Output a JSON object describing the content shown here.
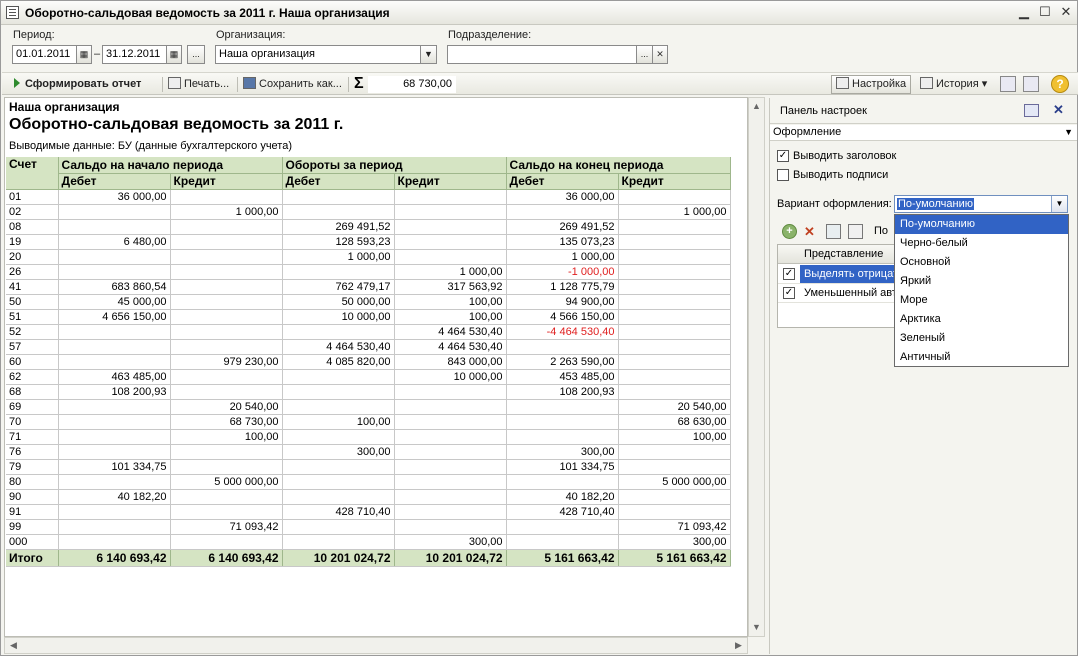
{
  "window": {
    "title": "Оборотно-сальдовая ведомость за 2011 г. Наша организация"
  },
  "filters": {
    "period_label": "Период:",
    "period_from": "01.01.2011",
    "period_sep": "–",
    "period_to": "31.12.2011",
    "period_btn": "...",
    "org_label": "Организация:",
    "org_value": "Наша организация",
    "dept_label": "Подразделение:",
    "dept_value": "",
    "dept_btn": "...",
    "dept_clear": "✕"
  },
  "toolbar": {
    "generate": "Сформировать отчет",
    "print": "Печать...",
    "save": "Сохранить как...",
    "sigma": "Σ",
    "sum_value": "68 730,00",
    "settings": "Настройка",
    "history": "История ▾",
    "help": "?"
  },
  "report": {
    "org": "Наша организация",
    "title": "Оборотно-сальдовая ведомость за 2011 г.",
    "subtitle": "Выводимые данные:  БУ (данные бухгалтерского учета)",
    "headers": {
      "account": "Счет",
      "start": "Сальдо на начало периода",
      "turnover": "Обороты за период",
      "end": "Сальдо на конец периода",
      "debit": "Дебет",
      "credit": "Кредит"
    },
    "rows": [
      [
        "01",
        "36 000,00",
        "",
        "",
        "",
        "36 000,00",
        ""
      ],
      [
        "02",
        "",
        "1 000,00",
        "",
        "",
        "",
        "1 000,00"
      ],
      [
        "08",
        "",
        "",
        "269 491,52",
        "",
        "269 491,52",
        ""
      ],
      [
        "19",
        "6 480,00",
        "",
        "128 593,23",
        "",
        "135 073,23",
        ""
      ],
      [
        "20",
        "",
        "",
        "1 000,00",
        "",
        "1 000,00",
        ""
      ],
      [
        "26",
        "",
        "",
        "",
        "1 000,00",
        "-1 000,00",
        ""
      ],
      [
        "41",
        "683 860,54",
        "",
        "762 479,17",
        "317 563,92",
        "1 128 775,79",
        ""
      ],
      [
        "50",
        "45 000,00",
        "",
        "50 000,00",
        "100,00",
        "94 900,00",
        ""
      ],
      [
        "51",
        "4 656 150,00",
        "",
        "10 000,00",
        "100,00",
        "4 566 150,00",
        ""
      ],
      [
        "52",
        "",
        "",
        "",
        "4 464 530,40",
        "-4 464 530,40",
        ""
      ],
      [
        "57",
        "",
        "",
        "4 464 530,40",
        "4 464 530,40",
        "",
        ""
      ],
      [
        "60",
        "",
        "979 230,00",
        "4 085 820,00",
        "843 000,00",
        "2 263 590,00",
        ""
      ],
      [
        "62",
        "463 485,00",
        "",
        "",
        "10 000,00",
        "453 485,00",
        ""
      ],
      [
        "68",
        "108 200,93",
        "",
        "",
        "",
        "108 200,93",
        ""
      ],
      [
        "69",
        "",
        "20 540,00",
        "",
        "",
        "",
        "20 540,00"
      ],
      [
        "70",
        "",
        "68 730,00",
        "100,00",
        "",
        "",
        "68 630,00"
      ],
      [
        "71",
        "",
        "100,00",
        "",
        "",
        "",
        "100,00"
      ],
      [
        "76",
        "",
        "",
        "300,00",
        "",
        "300,00",
        ""
      ],
      [
        "79",
        "101 334,75",
        "",
        "",
        "",
        "101 334,75",
        ""
      ],
      [
        "80",
        "",
        "5 000 000,00",
        "",
        "",
        "",
        "5 000 000,00"
      ],
      [
        "90",
        "40 182,20",
        "",
        "",
        "",
        "40 182,20",
        ""
      ],
      [
        "91",
        "",
        "",
        "428 710,40",
        "",
        "428 710,40",
        ""
      ],
      [
        "99",
        "",
        "71 093,42",
        "",
        "",
        "",
        "71 093,42"
      ],
      [
        "000",
        "",
        "",
        "",
        "300,00",
        "",
        "300,00"
      ]
    ],
    "negative_cells": [
      [
        5,
        5
      ],
      [
        9,
        5
      ]
    ],
    "total": [
      "Итого",
      "6 140 693,42",
      "6 140 693,42",
      "10 201 024,72",
      "10 201 024,72",
      "5 161 663,42",
      "5 161 663,42"
    ]
  },
  "panel": {
    "title": "Панель настроек",
    "section": "Оформление",
    "show_header_label": "Выводить заголовок",
    "show_header_checked": true,
    "show_signatures_label": "Выводить подписи",
    "show_signatures_checked": false,
    "variant_label": "Вариант оформления:",
    "variant_value": "По-умолчанию",
    "variant_options": [
      "По-умолчанию",
      "Черно-белый",
      "Основной",
      "Яркий",
      "Море",
      "Арктика",
      "Зеленый",
      "Античный"
    ],
    "table_header": "Представление",
    "table_header_cut": "По",
    "table_rows": [
      "Выделять отрицательные",
      "Уменьшенный автоотступ"
    ]
  },
  "colors": {
    "header_bg": "#d5e4c3",
    "negative": "#e02020",
    "selection": "#3163c5"
  }
}
